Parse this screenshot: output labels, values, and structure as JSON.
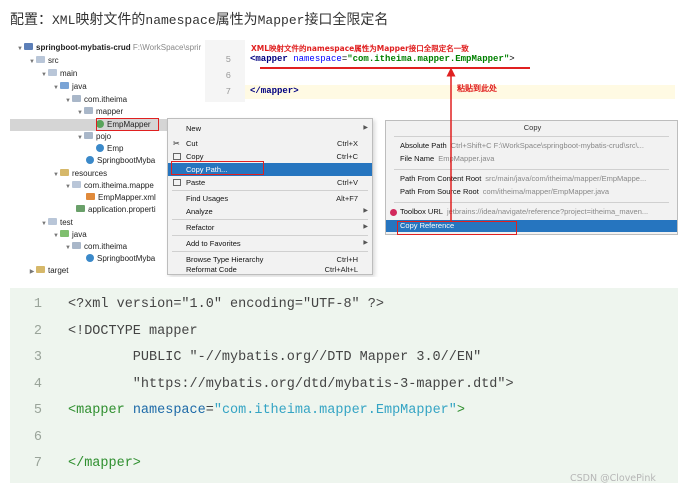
{
  "heading": {
    "prefix": "配置：",
    "mono1": "XML",
    "mid1": "映射文件的",
    "mono2": "namespace",
    "mid2": "属性为",
    "mono3": "Mapper",
    "suffix": "接口全限定名"
  },
  "tree": {
    "root_label": "springboot-mybatis-crud",
    "root_path": "F:\\WorkSpace\\sprir",
    "items": [
      {
        "label": "src"
      },
      {
        "label": "main"
      },
      {
        "label": "java"
      },
      {
        "label": "com.itheima"
      },
      {
        "label": "mapper"
      },
      {
        "label": "EmpMapper"
      },
      {
        "label": "pojo"
      },
      {
        "label": "Emp"
      },
      {
        "label": "SpringbootMyba"
      },
      {
        "label": "resources"
      },
      {
        "label": "com.itheima.mappe"
      },
      {
        "label": "EmpMapper.xml"
      },
      {
        "label": "application.properti"
      },
      {
        "label": "test"
      },
      {
        "label": "java"
      },
      {
        "label": "com.itheima"
      },
      {
        "label": "SpringbootMyba"
      },
      {
        "label": "target"
      }
    ]
  },
  "editor": {
    "line_numbers": [
      "5",
      "6",
      "7"
    ],
    "line5": {
      "open": "<mapper ",
      "attr": "namespace",
      "eq": "=",
      "str": "\"com.itheima.mapper.EmpMapper\"",
      "close": ">"
    },
    "line7": "</mapper>",
    "annotation_top": "XML映射文件的namespace属性为Mapper接口全限定名一致",
    "annotation_paste": "粘贴到此处"
  },
  "context_menu": {
    "items": [
      {
        "label": "New",
        "shortcut": "",
        "submenu": true
      },
      {
        "label": "Cut",
        "shortcut": "Ctrl+X",
        "submenu": false
      },
      {
        "label": "Copy",
        "shortcut": "Ctrl+C",
        "submenu": false
      },
      {
        "label": "Copy Path...",
        "shortcut": "",
        "submenu": false
      },
      {
        "label": "Paste",
        "shortcut": "Ctrl+V",
        "submenu": false
      },
      {
        "label": "Find Usages",
        "shortcut": "Alt+F7",
        "submenu": false
      },
      {
        "label": "Analyze",
        "shortcut": "",
        "submenu": true
      },
      {
        "label": "Refactor",
        "shortcut": "",
        "submenu": true
      },
      {
        "label": "Add to Favorites",
        "shortcut": "",
        "submenu": true
      },
      {
        "label": "Browse Type Hierarchy",
        "shortcut": "Ctrl+H",
        "submenu": false
      },
      {
        "label": "Reformat Code",
        "shortcut": "Ctrl+Alt+L",
        "submenu": false
      }
    ]
  },
  "copy_submenu": {
    "title": "Copy",
    "rows": [
      {
        "label": "Absolute Path",
        "hint": "Ctrl+Shift+C   F:\\WorkSpace\\springboot-mybatis-crud\\src\\..."
      },
      {
        "label": "File Name",
        "hint": "EmpMapper.java"
      },
      {
        "label": "Path From Content Root",
        "hint": "src/main/java/com/itheima/mapper/EmpMappe..."
      },
      {
        "label": "Path From Source Root",
        "hint": "com/itheima/mapper/EmpMapper.java"
      },
      {
        "label": "Toolbox URL",
        "hint": "jetbrains://idea/navigate/reference?project=itheima_maven..."
      },
      {
        "label": "Copy Reference",
        "hint": ""
      }
    ]
  },
  "code_block": {
    "line_numbers": [
      "1",
      "2",
      "3",
      "4",
      "5",
      "6",
      "7"
    ],
    "line1": "<?xml version=\"1.0\" encoding=\"UTF-8\" ?>",
    "line2": "<!DOCTYPE mapper",
    "line3": "        PUBLIC \"-//mybatis.org//DTD Mapper 3.0//EN\"",
    "line4": "        \"https://mybatis.org/dtd/mybatis-3-mapper.dtd\">",
    "line5_open": "<mapper ",
    "line5_attr": "namespace",
    "line5_eq": "=",
    "line5_str": "\"com.itheima.mapper.EmpMapper\"",
    "line5_close": ">",
    "line6": "",
    "line7": "</mapper>"
  },
  "watermark": "CSDN @ClovePink",
  "colors": {
    "annotation": "#e02020",
    "menu_highlight": "#2675bf",
    "code_bg": "#eef5ee"
  }
}
